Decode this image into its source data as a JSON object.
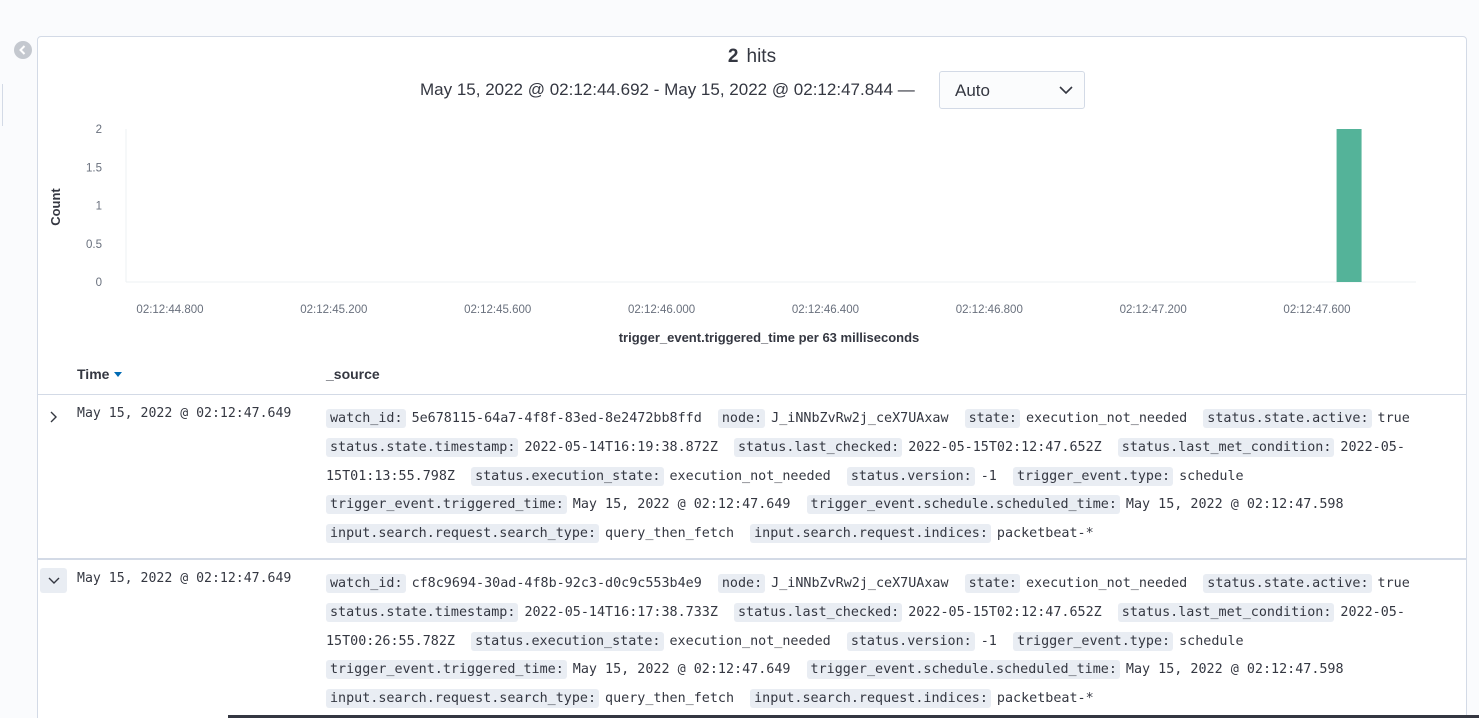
{
  "hits": {
    "count": "2",
    "label": "hits"
  },
  "time_range": {
    "text": "May 15, 2022 @ 02:12:44.692 - May 15, 2022 @ 02:12:47.844 —"
  },
  "interval": {
    "selected": "Auto"
  },
  "chart_data": {
    "type": "bar",
    "x": [
      "02:12:47.649"
    ],
    "values": [
      2
    ],
    "ylabel": "Count",
    "xlabel": "trigger_event.triggered_time per 63 milliseconds",
    "yticks": [
      "2",
      "1.5",
      "1",
      "0.5",
      "0"
    ],
    "xticks": [
      "02:12:44.800",
      "02:12:45.200",
      "02:12:45.600",
      "02:12:46.000",
      "02:12:46.400",
      "02:12:46.800",
      "02:12:47.200",
      "02:12:47.600"
    ],
    "ylim": [
      0,
      2
    ],
    "grid": false,
    "bar_color": "#54b399"
  },
  "table": {
    "headers": {
      "time": "Time",
      "source": "_source"
    },
    "rows": [
      {
        "time": "May 15, 2022 @ 02:12:47.649",
        "expanded": false,
        "fields": [
          {
            "k": "watch_id:",
            "v": "5e678115-64a7-4f8f-83ed-8e2472bb8ffd"
          },
          {
            "k": "node:",
            "v": "J_iNNbZvRw2j_ceX7UAxaw"
          },
          {
            "k": "state:",
            "v": "execution_not_needed"
          },
          {
            "k": "status.state.active:",
            "v": "true"
          },
          {
            "k": "status.state.timestamp:",
            "v": "2022-05-14T16:19:38.872Z"
          },
          {
            "k": "status.last_checked:",
            "v": "2022-05-15T02:12:47.652Z"
          },
          {
            "k": "status.last_met_condition:",
            "v": "2022-05-15T01:13:55.798Z"
          },
          {
            "k": "status.execution_state:",
            "v": "execution_not_needed"
          },
          {
            "k": "status.version:",
            "v": "-1"
          },
          {
            "k": "trigger_event.type:",
            "v": "schedule"
          },
          {
            "k": "trigger_event.triggered_time:",
            "v": "May 15, 2022 @ 02:12:47.649"
          },
          {
            "k": "trigger_event.schedule.scheduled_time:",
            "v": "May 15, 2022 @ 02:12:47.598"
          },
          {
            "k": "input.search.request.search_type:",
            "v": "query_then_fetch"
          },
          {
            "k": "input.search.request.indices:",
            "v": "packetbeat-*"
          }
        ]
      },
      {
        "time": "May 15, 2022 @ 02:12:47.649",
        "expanded": true,
        "fields": [
          {
            "k": "watch_id:",
            "v": "cf8c9694-30ad-4f8b-92c3-d0c9c553b4e9"
          },
          {
            "k": "node:",
            "v": "J_iNNbZvRw2j_ceX7UAxaw"
          },
          {
            "k": "state:",
            "v": "execution_not_needed"
          },
          {
            "k": "status.state.active:",
            "v": "true"
          },
          {
            "k": "status.state.timestamp:",
            "v": "2022-05-14T16:17:38.733Z"
          },
          {
            "k": "status.last_checked:",
            "v": "2022-05-15T02:12:47.652Z"
          },
          {
            "k": "status.last_met_condition:",
            "v": "2022-05-15T00:26:55.782Z"
          },
          {
            "k": "status.execution_state:",
            "v": "execution_not_needed"
          },
          {
            "k": "status.version:",
            "v": "-1"
          },
          {
            "k": "trigger_event.type:",
            "v": "schedule"
          },
          {
            "k": "trigger_event.triggered_time:",
            "v": "May 15, 2022 @ 02:12:47.649"
          },
          {
            "k": "trigger_event.schedule.scheduled_time:",
            "v": "May 15, 2022 @ 02:12:47.598"
          },
          {
            "k": "input.search.request.search_type:",
            "v": "query_then_fetch"
          },
          {
            "k": "input.search.request.indices:",
            "v": "packetbeat-*"
          }
        ]
      }
    ]
  },
  "icons": {
    "back": "arrow-left-circle-icon",
    "expand": "chevron-right-icon",
    "collapse": "chevron-down-icon",
    "dropdown": "chevron-down-icon",
    "sort": "sort-down-icon"
  }
}
